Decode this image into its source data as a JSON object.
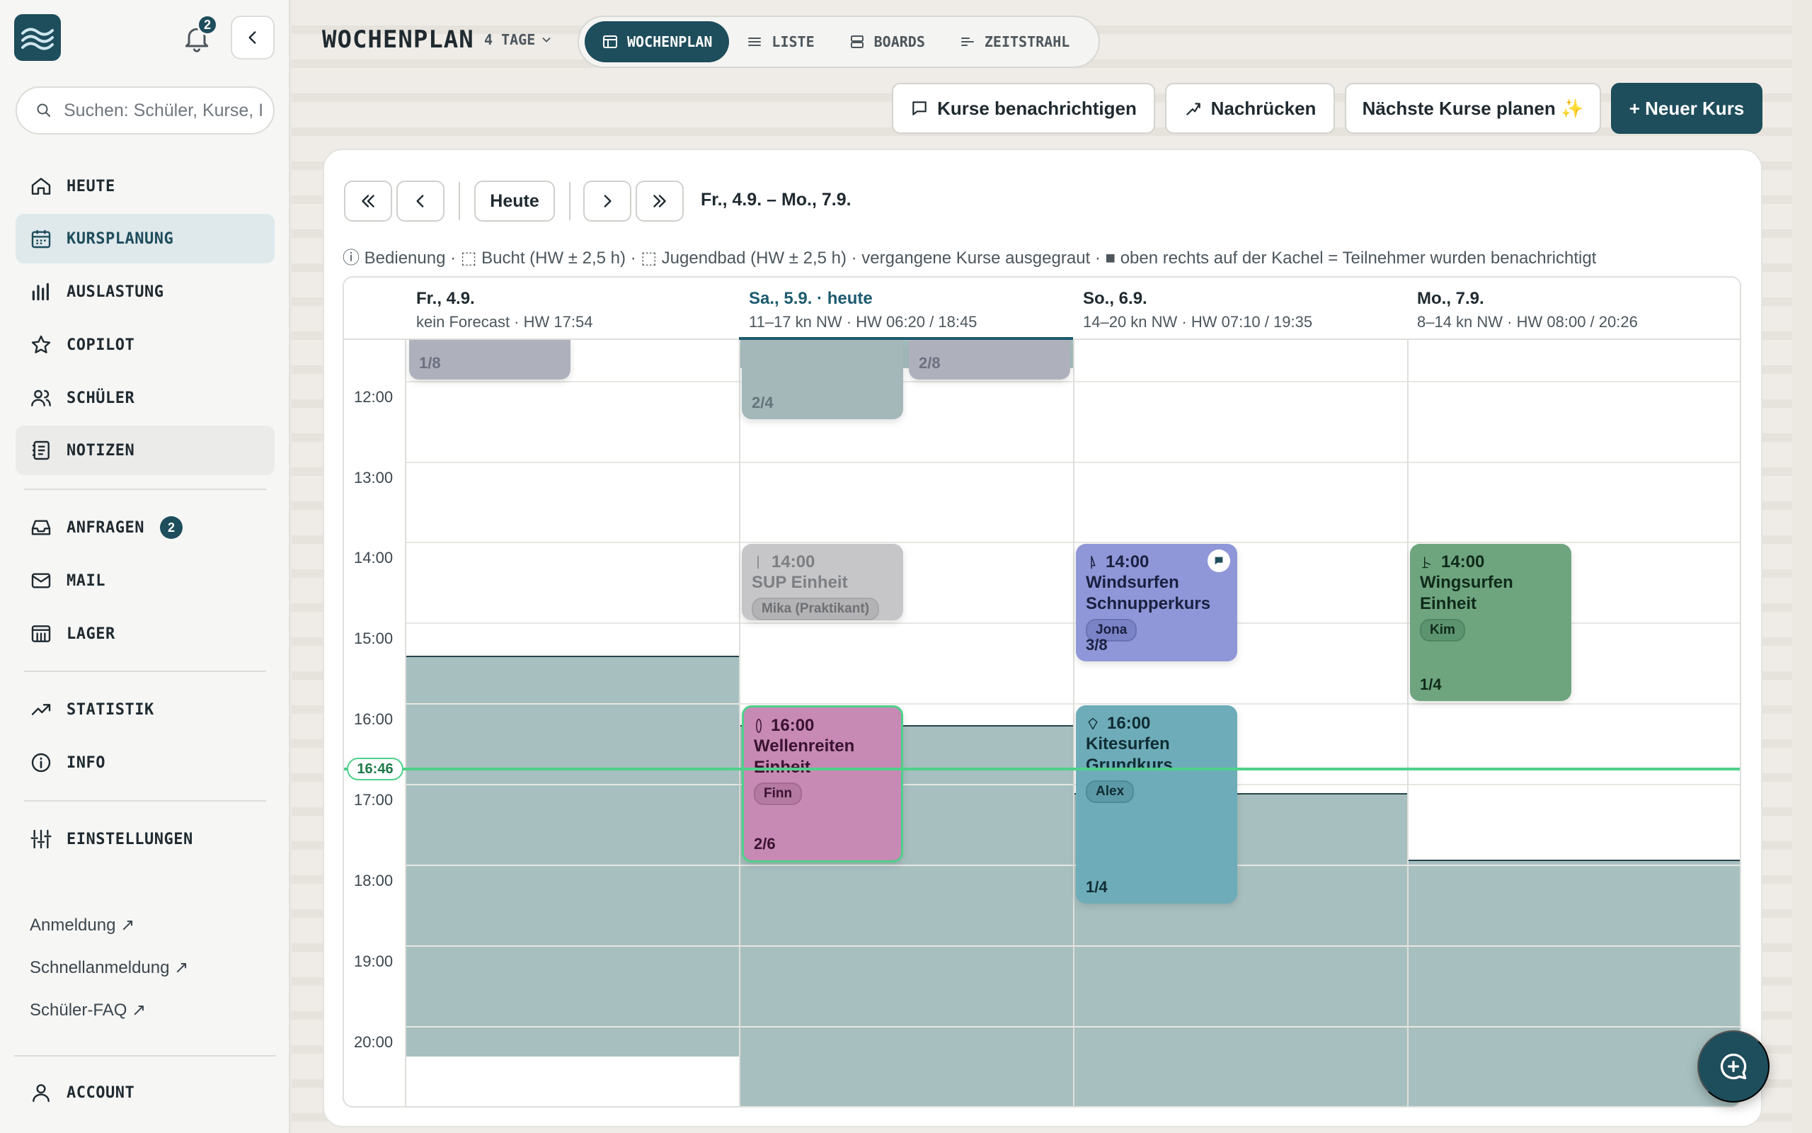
{
  "sidebar": {
    "notification_count": "2",
    "search_placeholder": "Suchen: Schüler, Kurse, I",
    "items": [
      {
        "label": "HEUTE"
      },
      {
        "label": "KURSPLANUNG"
      },
      {
        "label": "AUSLASTUNG"
      },
      {
        "label": "COPILOT"
      },
      {
        "label": "SCHÜLER"
      },
      {
        "label": "NOTIZEN"
      },
      {
        "label": "ANFRAGEN",
        "badge": "2"
      },
      {
        "label": "MAIL"
      },
      {
        "label": "LAGER"
      },
      {
        "label": "STATISTIK"
      },
      {
        "label": "INFO"
      },
      {
        "label": "EINSTELLUNGEN"
      }
    ],
    "links": [
      "Anmeldung ↗",
      "Schnellanmeldung ↗",
      "Schüler-FAQ ↗"
    ],
    "account_label": "ACCOUNT"
  },
  "header": {
    "title": "WOCHENPLAN",
    "days_select": "4 TAGE",
    "tabs": [
      {
        "label": "WOCHENPLAN"
      },
      {
        "label": "LISTE"
      },
      {
        "label": "BOARDS"
      },
      {
        "label": "ZEITSTRAHL"
      }
    ],
    "actions": {
      "notify": "Kurse benachrichtigen",
      "advance": "Nachrücken",
      "plan": "Nächste Kurse planen ✨",
      "new": "+ Neuer Kurs"
    }
  },
  "calendar": {
    "today_label": "Heute",
    "range": "Fr., 4.9. – Mo., 7.9.",
    "legend": "ⓘ Bedienung · ⬚ Bucht (HW ± 2,5 h) · ⬚ Jugendbad (HW ± 2,5 h) · vergangene Kurse ausgegraut · ■ oben rechts auf der Kachel = Teilnehmer wurden benachrichtigt",
    "days": [
      {
        "title": "Fr., 4.9.",
        "sub": "kein Forecast · HW 17:54"
      },
      {
        "title": "Sa., 5.9. · heute",
        "sub": "11–17 kn NW · HW 06:20 / 18:45"
      },
      {
        "title": "So., 6.9.",
        "sub": "14–20 kn NW · HW 07:10 / 19:35"
      },
      {
        "title": "Mo., 7.9.",
        "sub": "8–14 kn NW · HW 08:00 / 20:26"
      }
    ],
    "hours": [
      "12:00",
      "13:00",
      "14:00",
      "15:00",
      "16:00",
      "17:00",
      "18:00",
      "19:00",
      "20:00"
    ],
    "now": "16:46",
    "events": {
      "fr_past": {
        "count": "1/8"
      },
      "sa_past_a": {
        "count": "2/4"
      },
      "sa_past_b": {
        "count": "2/8"
      },
      "sup": {
        "time": "14:00",
        "title": "SUP Einheit",
        "coach": "Mika (Praktikant)"
      },
      "wind": {
        "time": "14:00",
        "title": "Windsurfen Schnupperkurs",
        "coach": "Jona",
        "count": "3/8"
      },
      "wing": {
        "time": "14:00",
        "title": "Wingsurfen Einheit",
        "coach": "Kim",
        "count": "1/4"
      },
      "wave": {
        "time": "16:00",
        "title": "Wellenreiten Einheit",
        "coach": "Finn",
        "count": "2/6"
      },
      "kite": {
        "time": "16:00",
        "title": "Kitesurfen Grundkurs",
        "coach": "Alex",
        "count": "1/4"
      }
    }
  }
}
